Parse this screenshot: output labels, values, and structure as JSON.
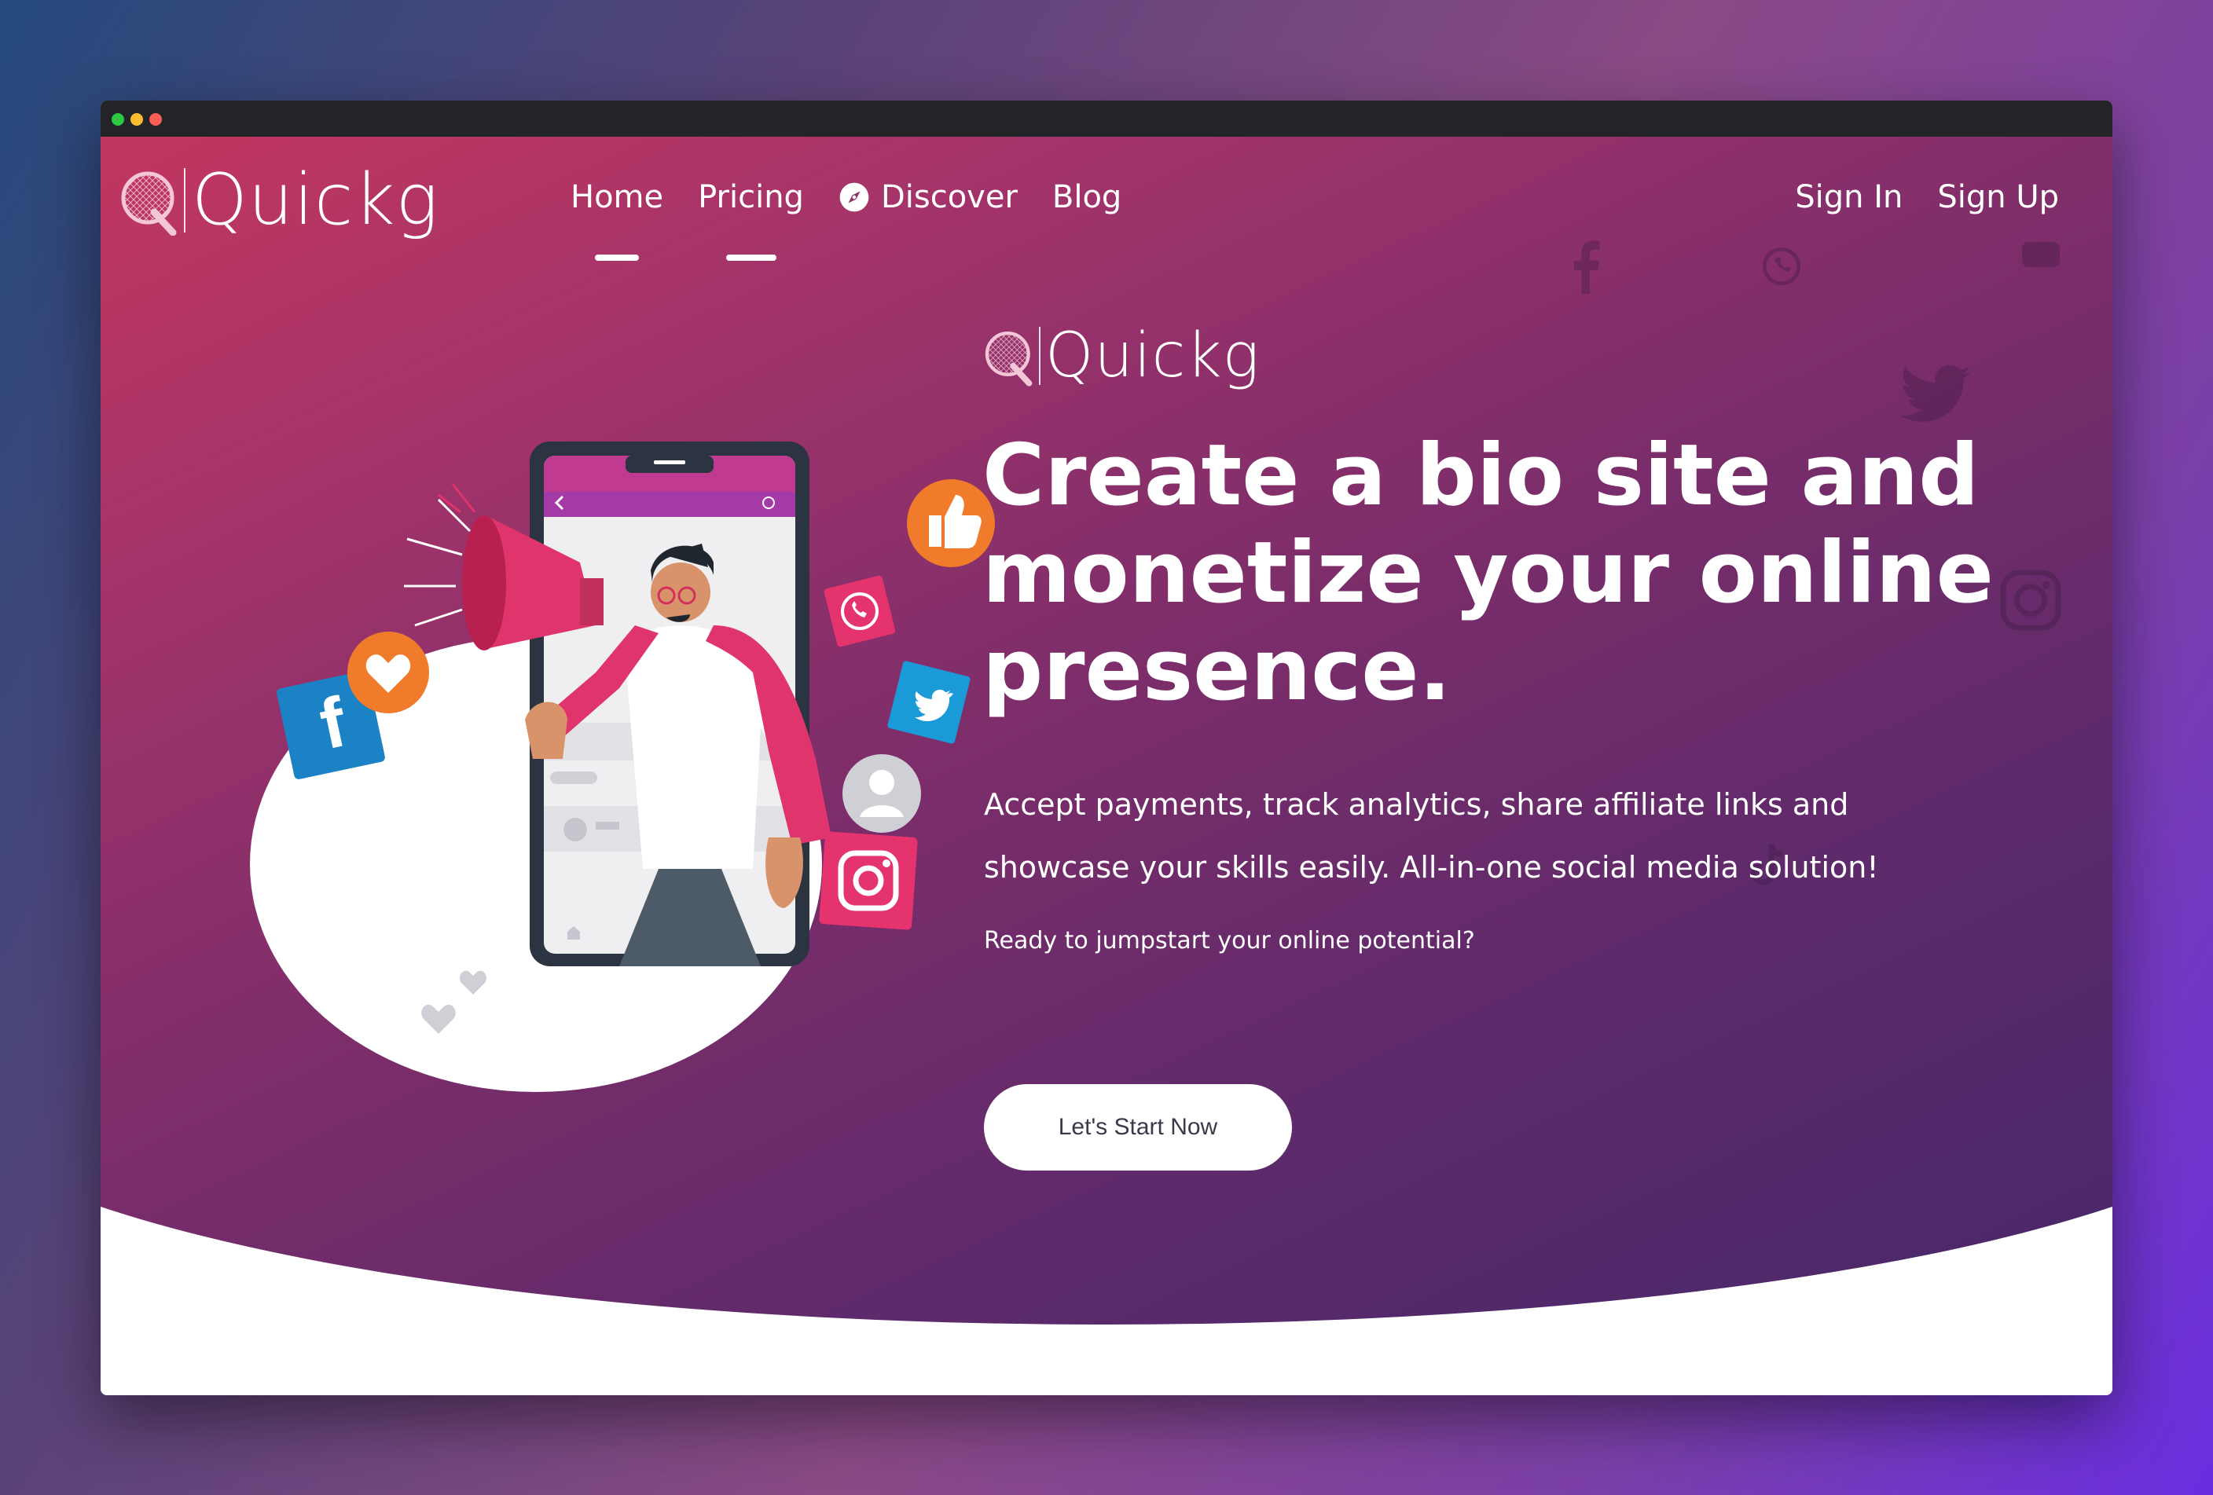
{
  "brand": {
    "name": "Quickg",
    "mark_letter": "Q"
  },
  "nav": {
    "home": "Home",
    "pricing": "Pricing",
    "discover": "Discover",
    "blog": "Blog"
  },
  "auth": {
    "sign_in": "Sign In",
    "sign_up": "Sign Up"
  },
  "hero": {
    "brand_name": "Quickg",
    "headline": [
      "Create a bio site and",
      "monetize your online",
      "presence."
    ],
    "subtitle": [
      "Accept payments, track analytics, share affiliate links and",
      "showcase your skills easily. All-in-one social media solution!"
    ],
    "ready": "Ready to jumpstart your online potential?",
    "cta": "Let's Start Now"
  },
  "colors": {
    "gradient_start": "#c2375f",
    "gradient_end": "#44286a",
    "accent_pink": "#e0356c",
    "orange": "#f07b2b",
    "facebook_blue": "#1b82c5",
    "twitter_blue": "#1b9ad8",
    "instagram_pink": "#e5336e"
  },
  "icons": [
    "quickg-logo-icon",
    "compass-icon",
    "facebook-icon",
    "twitter-icon",
    "whatsapp-icon",
    "instagram-icon",
    "thumbs-up-icon",
    "heart-icon",
    "megaphone-icon",
    "avatar-icon"
  ]
}
